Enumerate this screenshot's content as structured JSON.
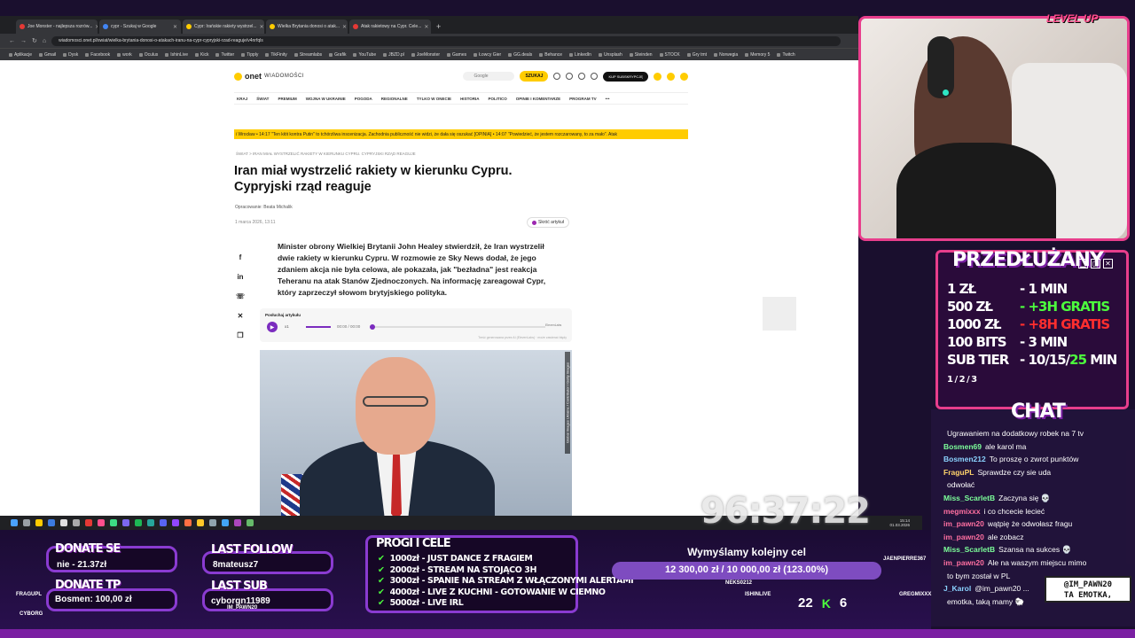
{
  "browser": {
    "tabs": [
      "Joe Monster - najlepsza rozrów...",
      "cypr - Szukaj w Google",
      "Cypr: Irańskie rakiety wystrzel...",
      "Wielka Brytania donosi o atak...",
      "Atak rakietowy na Cypr. Cele..."
    ],
    "new_tab": "+",
    "url": "wiadomosci.onet.pl/swiat/wielka-brytania-donosi-o-atakach-iranu-na-cypr-cypryjski-rzad-reaguje/v4nrfqls",
    "bookmarks": [
      "Aplikacje",
      "Gmail",
      "Dysk",
      "Facebook",
      "work",
      "Oculus",
      "IshinLive",
      "Kick",
      "Twitter",
      "Tipply",
      "TikFinity",
      "Streamlabs",
      "Grafik",
      "YouTube",
      "JBZD.pl",
      "JoeMonster",
      "Games",
      "Łowcy Gier",
      "GG.deals",
      "Behance",
      "LinkedIn",
      "Unsplash",
      "Steinden",
      "STOCK",
      "Gry tmt",
      "Norwegia",
      "Memory 5",
      "Twitch"
    ]
  },
  "onet": {
    "logo": "onet",
    "logo_sub": "WIADOMOŚCI",
    "search_placeholder": "Google",
    "search_button": "SZUKAJ",
    "subscribe": "KUP SUBSKRYPCJĘ",
    "nav": [
      "KRAJ",
      "ŚWIAT",
      "PREMIUM",
      "WOJNA W UKRAINIE",
      "POGODA",
      "REGIONALNE",
      "TYLKO W ONECIE",
      "HISTORIA",
      "POLITICO",
      "OPINIE I KOMENTARZE",
      "PROGRAM TV",
      "•••"
    ],
    "ticker": "i Wrocław  •  14:17  \"Ten kłót kontra Putin\" to tchórzliwa inscenizacja. Zachodnia publiczność nie widzi, że dała się oszukać [OPINIA]  •  14:07  \"Powiedzieć, że jestem rozczarowany, to za mało\". Atak",
    "breadcrumb": "ŚWIAT  >  IRAN MIAŁ WYSTRZELIĆ RAKIETY W KIERUNKU CYPRU. CYPRYJSKI RZĄD REAGUJE",
    "title": "Iran miał wystrzelić rakiety w kierunku Cypru. Cypryjski rząd reaguje",
    "author": "Opracowanie: Beata Michalik",
    "date": "1 marca 2026, 13:11",
    "summarize": "Skróć artykuł",
    "share_icons": [
      "f",
      "in",
      "☏",
      "✕",
      "❐"
    ],
    "lead": "Minister obrony Wielkiej Brytanii John Healey stwierdził, że Iran wystrzelił dwie rakiety w kierunku Cypru. W rozmowie ze Sky News dodał, że jego zdaniem akcja nie była celowa, ale pokazała, jak \"bezładna\" jest reakcja Teheranu na atak Stanów Zjednoczonych. Na informację zareagował Cypr, który zaprzeczył słowom brytyjskiego polityka.",
    "player": {
      "label": "Posłuchaj artykułu",
      "speed": "x1",
      "time": "00:00 / 00:00",
      "progress": 0,
      "generator": "ElevenLabs",
      "note": "Treść generowana przez AI (ElevenLabs) · może zawierać błędy"
    },
    "photo_credit": "Global Images Ukraine / Contributor / Getty Images"
  },
  "taskbar": {
    "clock_time": "15:14",
    "clock_date": "01.03.2026",
    "icon_colors": [
      "#4aa3ff",
      "#9aa0a6",
      "#ffcc00",
      "#3c7be0",
      "#e0e0e0",
      "#aaaaaa",
      "#e53935",
      "#ff4f8b",
      "#3ddc84",
      "#7b68ee",
      "#1db954",
      "#26a69a",
      "#5865f2",
      "#9146ff",
      "#ff7043",
      "#ffca28",
      "#90a4ae",
      "#42a5f5",
      "#ab47bc",
      "#66bb6a"
    ]
  },
  "stream": {
    "level_badge": "LEVEL UP",
    "rates_title": "PRZEDŁUŻANY",
    "rates": [
      {
        "left": "1 ZŁ",
        "right": "- 1 MIN",
        "color": "white"
      },
      {
        "left": "500 ZŁ",
        "right": "- +3H GRATIS",
        "color": "green"
      },
      {
        "left": "1000 ZŁ",
        "right": "- +8H GRATIS",
        "color": "red"
      },
      {
        "left": "100 BITS",
        "right": "- 3 MIN",
        "color": "white"
      }
    ],
    "subtier_label": "SUB TIER",
    "subtier_sub": "1 / 2 / 3",
    "subtier_value": "- 10/15/",
    "subtier_green": "25",
    "subtier_tail": " MIN",
    "chat_title": "CHAT",
    "chat": [
      {
        "nick": "",
        "text": "Ugrawaniem na dodatkowy robek na 7 tv",
        "cls": "n1"
      },
      {
        "nick": "Bosmen69",
        "text": "ale karol ma",
        "cls": "n4"
      },
      {
        "nick": "Bosmen212",
        "text": "To proszę o zwrot punktów",
        "cls": "n3"
      },
      {
        "nick": "FraguPL",
        "text": "Sprawdze czy sie uda",
        "cls": "n5"
      },
      {
        "nick": "",
        "text": "odwołać",
        "cls": "n1"
      },
      {
        "nick": "Miss_ScarletB",
        "text": "Zaczyna się 💀",
        "cls": "n4"
      },
      {
        "nick": "megmixxx",
        "text": "i co chcecie lecieć",
        "cls": "n2"
      },
      {
        "nick": "im_pawn20",
        "text": "wątpię że odwołasz fragu",
        "cls": "n2"
      },
      {
        "nick": "im_pawn20",
        "text": "ale zobacz",
        "cls": "n2"
      },
      {
        "nick": "Miss_ScarletB",
        "text": "Szansa na sukces 💀",
        "cls": "n4"
      },
      {
        "nick": "im_pawn20",
        "text": "Ale na waszym miejscu mimo",
        "cls": "n2"
      },
      {
        "nick": "",
        "text": "to bym został w PL",
        "cls": "n1"
      },
      {
        "nick": "J_Karol",
        "text": "@im_pawn20 ...",
        "cls": "n3"
      },
      {
        "nick": "",
        "text": "emotka, taką mamy 🐑",
        "cls": "n1"
      }
    ],
    "timer": "96:37:22",
    "donate_se_title": "DONATE SE",
    "donate_se_value": "nie - 21.37zł",
    "donate_tp_title": "DONATE TP",
    "donate_tp_value": "Bosmen: 100,00 zł",
    "last_follow_title": "LAST FOLLOW",
    "last_follow_value": "8mateusz7",
    "last_sub_title": "LAST SUB",
    "last_sub_value": "cyborgn11989",
    "goals_title": "PROGI I CELE",
    "goals": [
      "1000zł - JUST DANCE Z FRAGIEM",
      "2000zł - STREAM NA STOJĄCO 3H",
      "3000zł - SPANIE NA STREAM Z WŁĄCZONYMI ALERTAMI",
      "4000zł - LIVE Z KUCHNI - GOTOWANIE W CIEMNO",
      "5000zł - LIVE IRL"
    ],
    "target_title": "Wymyślamy kolejny cel",
    "target_text": "12 300,00 zł / 10 000,00 zł (123.00%)",
    "target_pct": 1.0,
    "viewers_twitch": "22",
    "viewers_kick": "6",
    "kick_icon": "K",
    "npc_names": [
      "FRAGUPL",
      "IM_PAWN20",
      "ISHINLIVE",
      "NEKS0212",
      "JAENPIERRE367",
      "GREGMIXXX",
      "CYBORG"
    ],
    "overlay_tag_line1": "@IM_PAWN20",
    "overlay_tag_line2": "TA EMOTKA,"
  }
}
